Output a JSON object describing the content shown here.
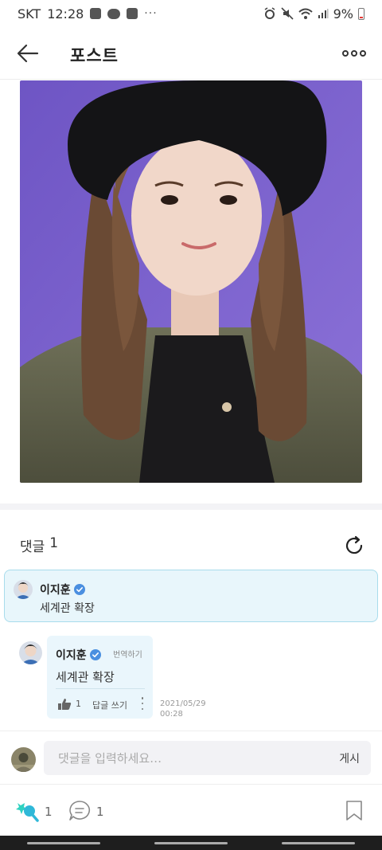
{
  "status_bar": {
    "carrier": "SKT",
    "time": "12:28",
    "overflow": "···",
    "battery": "9%",
    "icons": [
      "gallery-icon",
      "kakaotalk-icon",
      "chat-icon",
      "alarm-icon",
      "mute-icon",
      "wifi-icon",
      "signal-icon",
      "battery-icon"
    ]
  },
  "header": {
    "title": "포스트",
    "back_icon": "arrow-left-icon",
    "more_icon": "more-dots-icon"
  },
  "comments": {
    "label": "댓글",
    "count": "1",
    "refresh_icon": "refresh-icon",
    "featured": {
      "author": "이지훈",
      "text": "세계관 확장",
      "verified": true
    },
    "items": [
      {
        "author": "이지훈",
        "text": "세계관 확장",
        "translate_label": "번역하기",
        "likes": "1",
        "reply_label": "답글 쓰기",
        "date": "2021/05/29",
        "time": "00:28"
      }
    ]
  },
  "input": {
    "placeholder": "댓글을 입력하세요…",
    "post_label": "게시"
  },
  "actions": {
    "cheer_count": "1",
    "comment_count": "1",
    "cheer_icon": "cheer-stick-icon",
    "comment_icon": "comment-icon",
    "bookmark_icon": "bookmark-icon"
  },
  "colors": {
    "accent": "#2fb8d8",
    "featured_bg": "#e8f6fb",
    "photo_bg": "#7c63c9"
  }
}
